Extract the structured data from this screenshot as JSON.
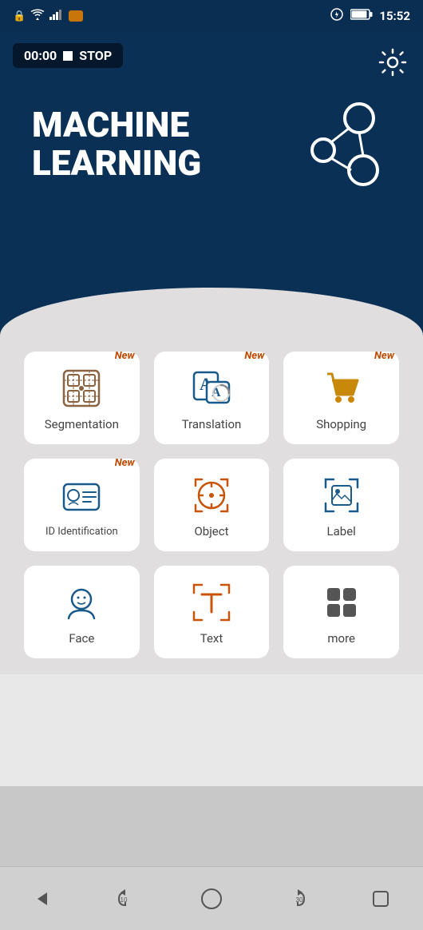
{
  "statusBar": {
    "time": "15:52",
    "icons": [
      "wifi",
      "signal",
      "battery",
      "lock"
    ]
  },
  "timer": {
    "display": "00:00",
    "stop_label": "STOP"
  },
  "header": {
    "title_line1": "MACHINE",
    "title_line2": "LEARNING"
  },
  "settings": {
    "icon": "⚙"
  },
  "grid": {
    "items": [
      {
        "id": "segmentation",
        "label": "Segmentation",
        "new": true
      },
      {
        "id": "translation",
        "label": "Translation",
        "new": true
      },
      {
        "id": "shopping",
        "label": "Shopping",
        "new": true
      },
      {
        "id": "id-identification",
        "label": "ID Identification",
        "new": true
      },
      {
        "id": "object",
        "label": "Object",
        "new": false
      },
      {
        "id": "label",
        "label": "Label",
        "new": false
      },
      {
        "id": "face",
        "label": "Face",
        "new": false
      },
      {
        "id": "text",
        "label": "Text",
        "new": false
      },
      {
        "id": "more",
        "label": "more",
        "new": false
      }
    ],
    "new_label": "New"
  },
  "bottomNav": {
    "back_label": "◀",
    "rewind_label": "↺10",
    "home_label": "○",
    "forward_label": "↻30",
    "square_label": "□"
  }
}
